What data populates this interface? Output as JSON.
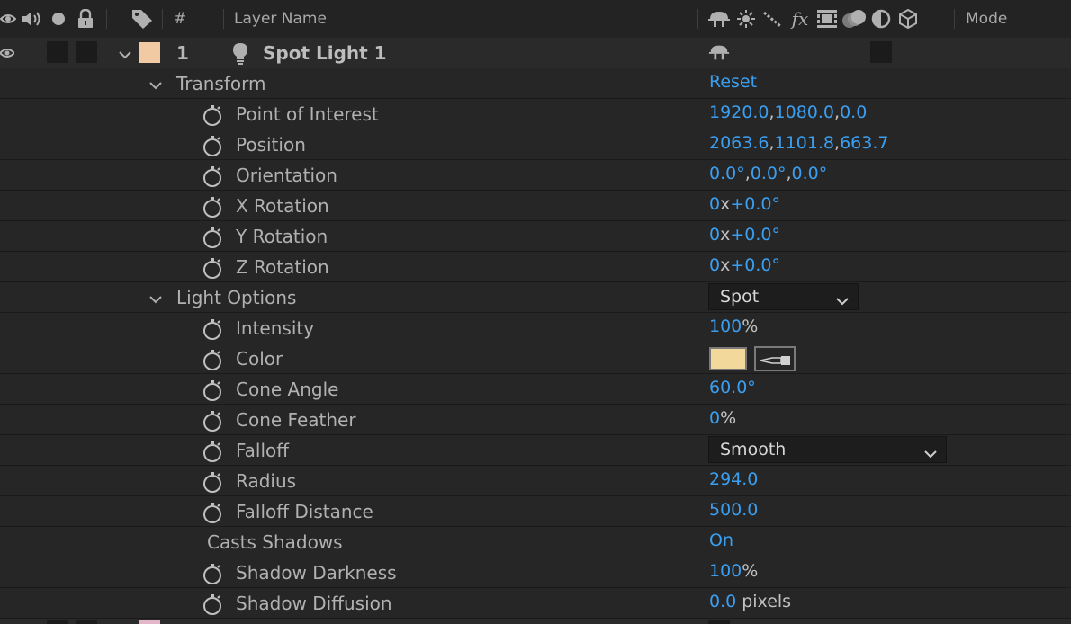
{
  "header": {
    "number_col": "#",
    "layer_name_col": "Layer Name",
    "mode_col": "Mode",
    "left_icons": [
      "eye-icon",
      "speaker-icon",
      "solo-dot-icon",
      "lock-icon",
      "label-tag-icon"
    ],
    "switch_icons": [
      "shy-icon",
      "collapse-sun-icon",
      "quality-icon",
      "fx-icon",
      "frame-blend-icon",
      "motion-blur-icon",
      "adjustment-icon",
      "3d-cube-icon"
    ]
  },
  "layer": {
    "number": "1",
    "name": "Spot Light 1",
    "label_color": "#f1c9a2",
    "type_icon": "light-bulb-icon",
    "switch_icon": "shy-icon"
  },
  "transform": {
    "label": "Transform",
    "reset": "Reset",
    "properties": [
      {
        "name": "Point of Interest",
        "values": [
          "1920.0",
          "1080.0",
          "0.0"
        ],
        "sep": ","
      },
      {
        "name": "Position",
        "values": [
          "2063.6",
          "1101.8",
          "663.7"
        ],
        "sep": ","
      },
      {
        "name": "Orientation",
        "values": [
          "0.0°",
          "0.0°",
          "0.0°"
        ],
        "sep": ","
      },
      {
        "name": "X Rotation",
        "rev": "0",
        "deg": "+0.0°"
      },
      {
        "name": "Y Rotation",
        "rev": "0",
        "deg": "+0.0°"
      },
      {
        "name": "Z Rotation",
        "rev": "0",
        "deg": "+0.0°"
      }
    ]
  },
  "light_options": {
    "label": "Light Options",
    "light_type": "Spot",
    "intensity": {
      "name": "Intensity",
      "value": "100",
      "unit": "%"
    },
    "color": {
      "name": "Color",
      "swatch": "#f2d99b"
    },
    "cone_angle": {
      "name": "Cone Angle",
      "value": "60.0°"
    },
    "cone_feather": {
      "name": "Cone Feather",
      "value": "0",
      "unit": "%"
    },
    "falloff": {
      "name": "Falloff",
      "value": "Smooth"
    },
    "radius": {
      "name": "Radius",
      "value": "294.0"
    },
    "falloff_distance": {
      "name": "Falloff Distance",
      "value": "500.0"
    },
    "casts_shadows": {
      "name": "Casts Shadows",
      "value": "On"
    },
    "shadow_darkness": {
      "name": "Shadow Darkness",
      "value": "100",
      "unit": "%"
    },
    "shadow_diffusion": {
      "name": "Shadow Diffusion",
      "value": "0.0",
      "unit": "pixels"
    }
  },
  "colors": {
    "background": "#232323",
    "value_blue": "#3b9ff1",
    "text": "#b1b1b1"
  }
}
